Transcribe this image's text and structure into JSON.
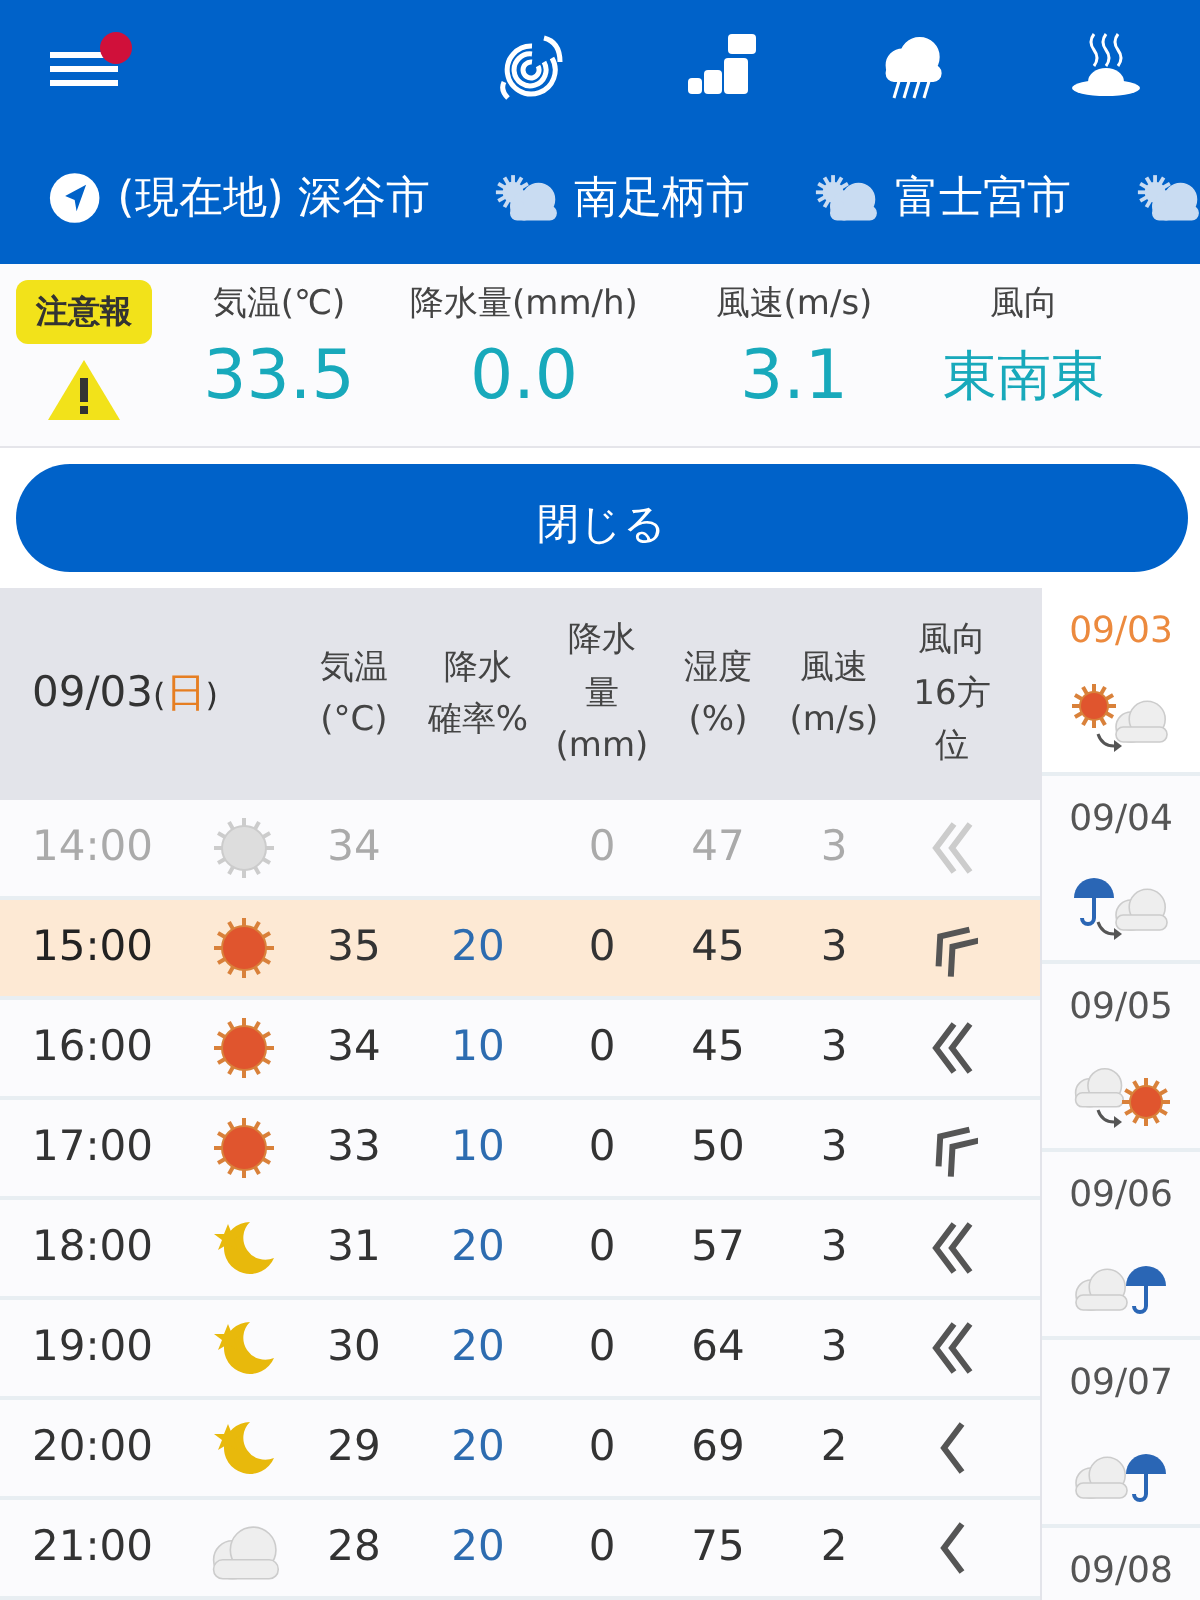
{
  "top_bar": {
    "notification": true,
    "icons": [
      {
        "kind": "typhoon"
      },
      {
        "kind": "blocks"
      },
      {
        "kind": "rain"
      },
      {
        "kind": "hot-spring"
      }
    ]
  },
  "locations": [
    {
      "kind": "current",
      "name": "(現在地) 深谷市"
    },
    {
      "kind": "weather",
      "name": "南足柄市"
    },
    {
      "kind": "weather",
      "name": "富士宮市"
    },
    {
      "kind": "weather"
    }
  ],
  "summary": {
    "alert": "注意報",
    "items": [
      {
        "label": "気温(℃)",
        "value": "33.5"
      },
      {
        "label": "降水量(mm/h)",
        "value": "0.0"
      },
      {
        "label": "風速(m/s)",
        "value": "3.1"
      },
      {
        "label": "風向",
        "value": "東南東",
        "kind": "text"
      }
    ]
  },
  "close_button": "閉じる",
  "table": {
    "date": "09/03",
    "weekday_open": "(",
    "weekday": "日",
    "weekday_close": ")",
    "columns": [
      [
        "気温",
        "(°C)"
      ],
      [
        "降水",
        "確率%"
      ],
      [
        "降水",
        "量",
        "(mm)"
      ],
      [
        "湿度",
        "(%)"
      ],
      [
        "風速",
        "(m/s)"
      ],
      [
        "風向",
        "16方",
        "位"
      ]
    ],
    "rows": [
      {
        "time": "14:00",
        "weather": {
          "kind": "sun-grey"
        },
        "temp": "34",
        "precip": "0",
        "humidity": "47",
        "wind": "3",
        "wind_arrow": {
          "kind": "double"
        },
        "past": true,
        "selected": false
      },
      {
        "time": "15:00",
        "weather": {
          "kind": "sun"
        },
        "temp": "35",
        "prob": "20",
        "precip": "0",
        "humidity": "45",
        "wind": "3",
        "wind_arrow": {
          "kind": "double-tilted"
        },
        "past": false,
        "selected": true
      },
      {
        "time": "16:00",
        "weather": {
          "kind": "sun"
        },
        "temp": "34",
        "prob": "10",
        "precip": "0",
        "humidity": "45",
        "wind": "3",
        "wind_arrow": {
          "kind": "double"
        },
        "past": false,
        "selected": false
      },
      {
        "time": "17:00",
        "weather": {
          "kind": "sun"
        },
        "temp": "33",
        "prob": "10",
        "precip": "0",
        "humidity": "50",
        "wind": "3",
        "wind_arrow": {
          "kind": "double-tilted"
        },
        "past": false,
        "selected": false
      },
      {
        "time": "18:00",
        "weather": {
          "kind": "moon"
        },
        "temp": "31",
        "prob": "20",
        "precip": "0",
        "humidity": "57",
        "wind": "3",
        "wind_arrow": {
          "kind": "double"
        },
        "past": false,
        "selected": false
      },
      {
        "time": "19:00",
        "weather": {
          "kind": "moon"
        },
        "temp": "30",
        "prob": "20",
        "precip": "0",
        "humidity": "64",
        "wind": "3",
        "wind_arrow": {
          "kind": "double"
        },
        "past": false,
        "selected": false
      },
      {
        "time": "20:00",
        "weather": {
          "kind": "moon"
        },
        "temp": "29",
        "prob": "20",
        "precip": "0",
        "humidity": "69",
        "wind": "2",
        "wind_arrow": {
          "kind": "single"
        },
        "past": false,
        "selected": false
      },
      {
        "time": "21:00",
        "weather": {
          "kind": "cloud"
        },
        "temp": "28",
        "prob": "20",
        "precip": "0",
        "humidity": "75",
        "wind": "2",
        "wind_arrow": {
          "kind": "single"
        },
        "past": false,
        "selected": false
      }
    ]
  },
  "days": [
    {
      "date": "09/03",
      "weather": {
        "kind": "sun-then-cloud"
      },
      "selected": true
    },
    {
      "date": "09/04",
      "weather": {
        "kind": "rain-then-cloud"
      },
      "selected": false
    },
    {
      "date": "09/05",
      "weather": {
        "kind": "cloud-then-sun"
      },
      "selected": false
    },
    {
      "date": "09/06",
      "weather": {
        "kind": "cloud-then-rain"
      },
      "selected": false
    },
    {
      "date": "09/07",
      "weather": {
        "kind": "cloud-then-rain"
      },
      "selected": false
    },
    {
      "date": "09/08",
      "selected": false
    }
  ]
}
